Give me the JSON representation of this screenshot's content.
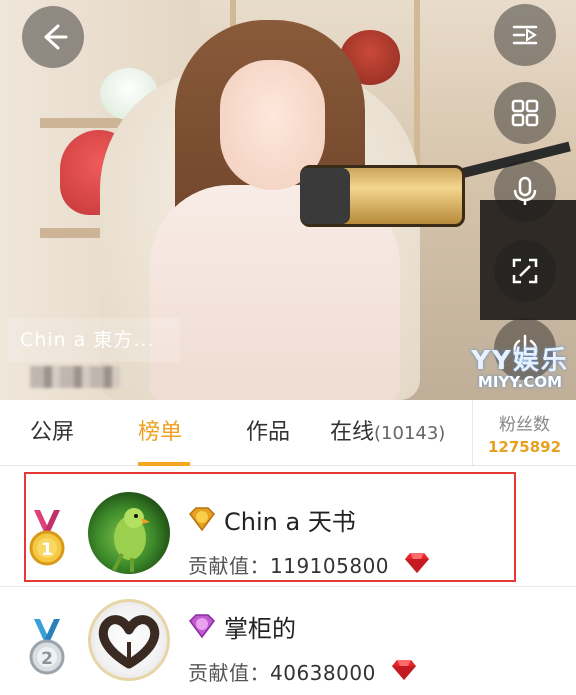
{
  "video": {
    "title": "Chin a 東方...",
    "watermark_logo": "YY娱乐",
    "watermark_url": "MIYY.COM",
    "controls": [
      "back-arrow-icon",
      "playlist-icon",
      "grid-icon",
      "microphone-icon",
      "fullscreen-icon",
      "power-icon"
    ]
  },
  "tabs": {
    "public_screen": "公屏",
    "ranking": "榜单",
    "works": "作品",
    "online": "在线",
    "online_count": "(10143)",
    "fans_label": "粉丝数",
    "fans_value": "1275892",
    "active": "榜单",
    "accent_color": "#f0a020"
  },
  "ranking": {
    "contrib_label": "贡献值：",
    "rows": [
      {
        "rank": "1",
        "name": "Chin a 天书",
        "contribution": "119105800",
        "highlighted": true
      },
      {
        "rank": "2",
        "name": "掌柜的",
        "contribution": "40638000",
        "highlighted": false
      }
    ],
    "highlight_color": "#e53935"
  }
}
